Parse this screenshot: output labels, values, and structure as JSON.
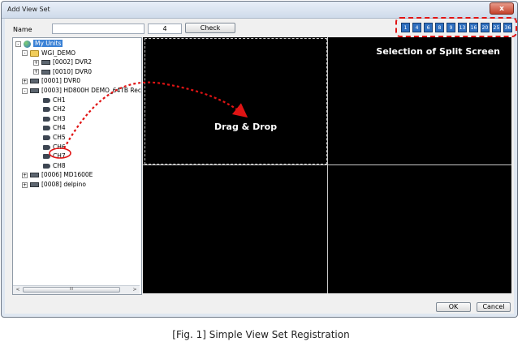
{
  "window": {
    "title": "Add View Set",
    "close_label": "x"
  },
  "form": {
    "name_label": "Name",
    "name_value": "",
    "count_value": "4",
    "check_label": "Check"
  },
  "split_buttons": [
    "1",
    "4",
    "6",
    "8",
    "9",
    "13",
    "16",
    "20",
    "25",
    "36"
  ],
  "tree": [
    {
      "label": "My Units",
      "icon": "globe-icon",
      "expander": "-",
      "selected": true
    },
    {
      "label": "WGI_DEMO",
      "icon": "folder-icon",
      "expander": "-"
    },
    {
      "label": "[0002] DVR2",
      "icon": "dvr-icon",
      "expander": "+"
    },
    {
      "label": "[0010] DVR0",
      "icon": "dvr-icon",
      "expander": "+"
    },
    {
      "label": "[0001] DVR0",
      "icon": "dvr-icon",
      "expander": "+"
    },
    {
      "label": "[0003] HD800H DEMO_64TB Rec",
      "icon": "dvr-icon",
      "expander": "-"
    },
    {
      "label": "CH1",
      "icon": "camera-icon"
    },
    {
      "label": "CH2",
      "icon": "camera-icon"
    },
    {
      "label": "CH3",
      "icon": "camera-icon"
    },
    {
      "label": "CH4",
      "icon": "camera-icon"
    },
    {
      "label": "CH5",
      "icon": "camera-icon"
    },
    {
      "label": "CH6",
      "icon": "camera-icon"
    },
    {
      "label": "CH7",
      "icon": "camera-icon",
      "highlighted": true
    },
    {
      "label": "CH8",
      "icon": "camera-icon"
    },
    {
      "label": "[0006] MD1600E",
      "icon": "dvr-icon",
      "expander": "+"
    },
    {
      "label": "[0008] delpino",
      "icon": "dvr-icon",
      "expander": "+"
    }
  ],
  "scrollbar": {
    "left_arrow": "<",
    "right_arrow": ">",
    "thumb_grip": "III"
  },
  "screen": {
    "split_callout": "Selection of Split Screen",
    "drag_callout": "Drag & Drop"
  },
  "footer": {
    "ok_label": "OK",
    "cancel_label": "Cancel"
  },
  "caption": "[Fig. 1] Simple View Set Registration",
  "colors": {
    "highlight_red": "#e01414",
    "selection_blue": "#3b82d6",
    "split_button_blue": "#2f6fbf"
  }
}
